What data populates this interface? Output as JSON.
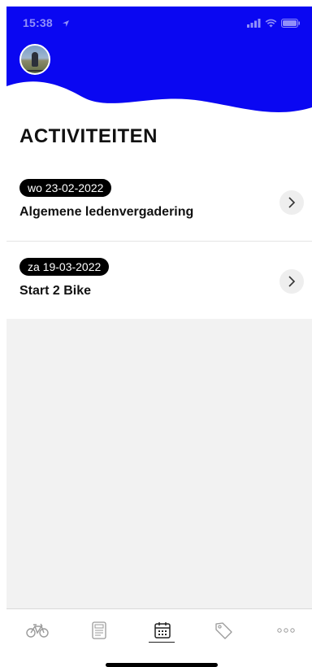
{
  "colors": {
    "header_blue": "#0a07f2",
    "badge_bg": "#000000",
    "empty_bg": "#f2f2f2"
  },
  "status_bar": {
    "time": "15:38"
  },
  "header": {
    "avatar": "avatar"
  },
  "page": {
    "title": "ACTIVITEITEN"
  },
  "activities": [
    {
      "date": "wo 23-02-2022",
      "name": "Algemene ledenvergadering",
      "icon": "chevron-right-icon"
    },
    {
      "date": "za 19-03-2022",
      "name": "Start 2 Bike",
      "icon": "chevron-right-icon"
    }
  ],
  "tab_bar": {
    "tabs": [
      {
        "icon": "bicycle-icon",
        "active": false
      },
      {
        "icon": "newspaper-icon",
        "active": false
      },
      {
        "icon": "calendar-icon",
        "active": true
      },
      {
        "icon": "tag-icon",
        "active": false
      },
      {
        "icon": "more-icon",
        "active": false
      }
    ]
  }
}
